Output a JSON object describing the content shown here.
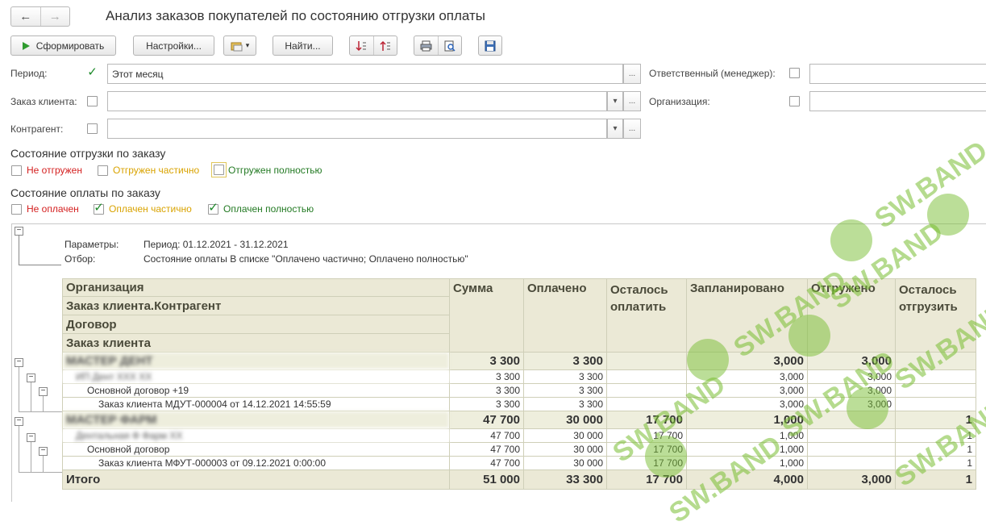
{
  "window": {
    "title": "Анализ заказов покупателей по состоянию отгрузки оплаты",
    "nav_back_icon": "arrow-left-icon",
    "nav_forward_icon": "arrow-right-icon"
  },
  "toolbar": {
    "generate_label": "Сформировать",
    "settings_label": "Настройки...",
    "find_label": "Найти..."
  },
  "filters": {
    "period_label": "Период:",
    "period_checked": true,
    "period_value": "Этот месяц",
    "order_label": "Заказ клиента:",
    "counterparty_label": "Контрагент:",
    "responsible_label": "Ответственный (менеджер):",
    "organization_label": "Организация:",
    "ellipsis": "...",
    "dropdown": "▾"
  },
  "shipment": {
    "title": "Состояние отгрузки по заказу",
    "options": [
      {
        "label": "Не отгружен",
        "checked": false
      },
      {
        "label": "Отгружен частично",
        "checked": false
      },
      {
        "label": "Отгружен полностью",
        "checked": false
      }
    ]
  },
  "payment": {
    "title": "Состояние оплаты по заказу",
    "options": [
      {
        "label": "Не оплачен",
        "checked": false
      },
      {
        "label": "Оплачен частично",
        "checked": true
      },
      {
        "label": "Оплачен полностью",
        "checked": true
      }
    ]
  },
  "report": {
    "params_label": "Параметры:",
    "params_value": "Период: 01.12.2021 - 31.12.2021",
    "filter_label": "Отбор:",
    "filter_value": "Состояние оплаты В списке \"Оплачено частично; Оплачено полностью\"",
    "group_headers": [
      "Организация",
      "Заказ клиента.Контрагент",
      "Договор",
      "Заказ клиента"
    ],
    "columns": [
      "Сумма",
      "Оплачено",
      "Осталось оплатить",
      "Запланировано",
      "Отгружено",
      "Осталось отгрузить"
    ],
    "rows": [
      {
        "level": 0,
        "name": "МАСТЕР ДЕНТ",
        "blurred": true,
        "values": [
          "3 300",
          "3 300",
          "",
          "3,000",
          "3,000",
          ""
        ]
      },
      {
        "level": 1,
        "name": "ИП Дент ХХХ ХХ",
        "blurred": true,
        "values": [
          "3 300",
          "3 300",
          "",
          "3,000",
          "3,000",
          ""
        ]
      },
      {
        "level": 2,
        "name": "Основной договор +19",
        "blurred": false,
        "values": [
          "3 300",
          "3 300",
          "",
          "3,000",
          "3,000",
          ""
        ]
      },
      {
        "level": 3,
        "name": "Заказ клиента МДУТ-000004 от 14.12.2021 14:55:59",
        "blurred": false,
        "values": [
          "3 300",
          "3 300",
          "",
          "3,000",
          "3,000",
          ""
        ]
      },
      {
        "level": 0,
        "name": "МАСТЕР ФАРМ",
        "blurred": true,
        "values": [
          "47 700",
          "30 000",
          "17 700",
          "1,000",
          "",
          "1"
        ]
      },
      {
        "level": 1,
        "name": "Дентальная Ф Фарм ХХ",
        "blurred": true,
        "values": [
          "47 700",
          "30 000",
          "17 700",
          "1,000",
          "",
          "1"
        ]
      },
      {
        "level": 2,
        "name": "Основной договор",
        "blurred": false,
        "values": [
          "47 700",
          "30 000",
          "17 700",
          "1,000",
          "",
          "1"
        ]
      },
      {
        "level": 3,
        "name": "Заказ клиента МФУТ-000003 от 09.12.2021 0:00:00",
        "blurred": false,
        "values": [
          "47 700",
          "30 000",
          "17 700",
          "1,000",
          "",
          "1"
        ]
      }
    ],
    "total": {
      "name": "Итого",
      "values": [
        "51 000",
        "33 300",
        "17 700",
        "4,000",
        "3,000",
        "1"
      ]
    }
  },
  "watermark": {
    "text": "SW.BAND",
    "color": "#78be32"
  }
}
